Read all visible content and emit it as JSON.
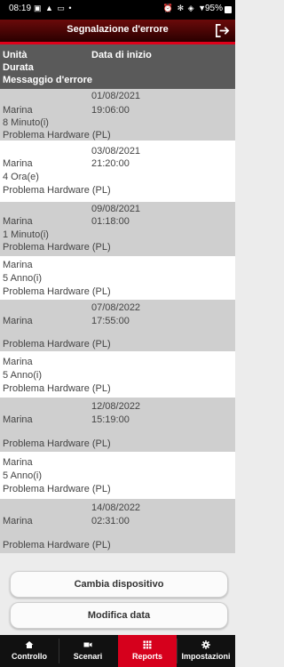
{
  "status": {
    "time": "08:19",
    "left_icons": "▣ ▲ ▭ •",
    "right_icons": "⏰ ✻ ◈ ▼",
    "battery": "95%"
  },
  "header": {
    "title": "Segnalazione d'errore"
  },
  "table": {
    "headers": {
      "unit": "Unità",
      "start_date": "Data di inizio",
      "duration": "Durata",
      "message": "Messaggio d'errore"
    },
    "rows": [
      {
        "date": "01/08/2021",
        "time": "19:06:00",
        "unit": "Marina",
        "duration": "8 Minuto(i)",
        "message": "Problema Hardware (PL)"
      },
      {
        "date": "03/08/2021",
        "time": "21:20:00",
        "unit": "Marina",
        "duration": "4 Ora(e)",
        "message": "Problema Hardware (PL)"
      },
      {
        "date": "09/08/2021",
        "time": "01:18:00",
        "unit": "Marina",
        "duration": "1 Minuto(i)",
        "message": "Problema Hardware (PL)"
      },
      {
        "date": "",
        "time": "",
        "unit": "Marina",
        "duration": "5 Anno(i)",
        "message": "Problema Hardware (PL)"
      },
      {
        "date": "07/08/2022",
        "time": "17:55:00",
        "unit": "Marina",
        "duration": "",
        "message": "Problema Hardware (PL)"
      },
      {
        "date": "",
        "time": "",
        "unit": "Marina",
        "duration": "5 Anno(i)",
        "message": "Problema Hardware (PL)"
      },
      {
        "date": "12/08/2022",
        "time": "15:19:00",
        "unit": "Marina",
        "duration": "",
        "message": "Problema Hardware (PL)"
      },
      {
        "date": "",
        "time": "",
        "unit": "Marina",
        "duration": "5 Anno(i)",
        "message": "Problema Hardware (PL)"
      },
      {
        "date": "14/08/2022",
        "time": "02:31:00",
        "unit": "Marina",
        "duration": "",
        "message": "Problema Hardware (PL)"
      }
    ]
  },
  "buttons": {
    "change_device": "Cambia dispositivo",
    "modify_date": "Modifica data"
  },
  "tabs": [
    {
      "label": "Controllo",
      "icon": "home-icon",
      "active": false
    },
    {
      "label": "Scenari",
      "icon": "camera-icon",
      "active": false
    },
    {
      "label": "Reports",
      "icon": "grid-icon",
      "active": true
    },
    {
      "label": "Impostazioni",
      "icon": "gear-icon",
      "active": false
    }
  ]
}
